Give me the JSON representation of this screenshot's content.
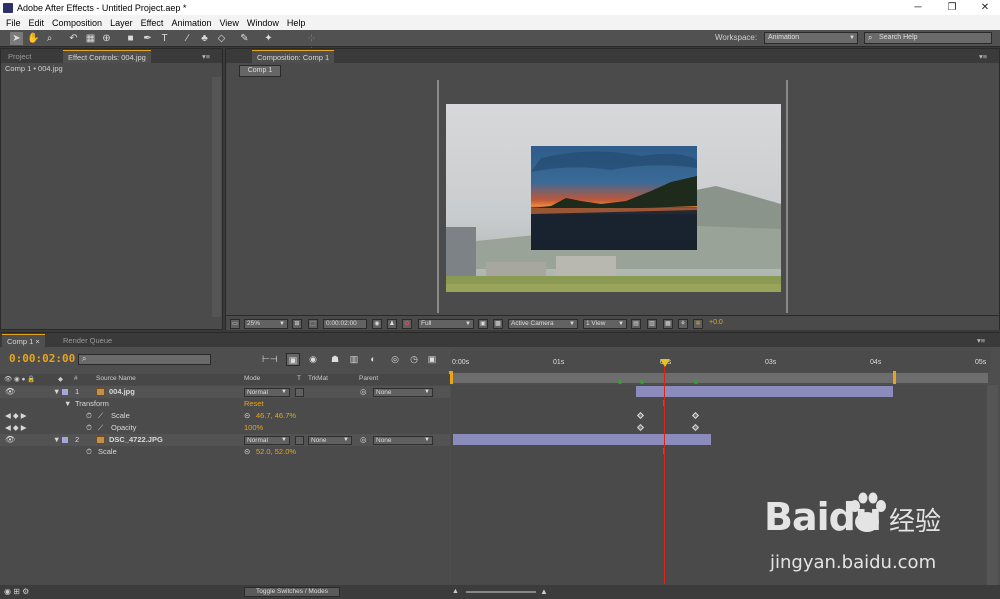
{
  "window": {
    "title": "Adobe After Effects - Untitled Project.aep *",
    "minimize": "─",
    "restore": "❐",
    "close": "✕"
  },
  "menu": [
    "File",
    "Edit",
    "Composition",
    "Layer",
    "Effect",
    "Animation",
    "View",
    "Window",
    "Help"
  ],
  "toolbar": {
    "workspace_label": "Workspace:",
    "workspace_value": "Animation",
    "search_placeholder": "Search Help"
  },
  "left_panel": {
    "tabs": [
      "Project",
      "Effect Controls: 004.jpg"
    ],
    "subtitle": "Comp 1 • 004.jpg"
  },
  "comp_panel": {
    "tab": "Composition: Comp 1",
    "sub_tab": "Comp 1",
    "zoom": "25%",
    "timecode": "0:00:02:00",
    "resolution": "Full",
    "camera": "Active Camera",
    "views": "1 View",
    "exposure": "+0.0"
  },
  "timeline": {
    "tabs": [
      "Comp 1",
      "Render Queue"
    ],
    "timecode": "0:00:02:00",
    "ruler_labels": [
      "0:00s",
      "01s",
      "02s",
      "03s",
      "04s",
      "05s"
    ],
    "columns": {
      "num": "#",
      "source": "Source Name",
      "mode": "Mode",
      "t": "T",
      "trkmat": "TrkMat",
      "parent": "Parent"
    },
    "layers": [
      {
        "num": "1",
        "name": "004.jpg",
        "mode": "Normal",
        "parent": "None",
        "transform_label": "Transform",
        "reset_label": "Reset",
        "props": [
          {
            "name": "Scale",
            "value": "46.7, 46.7%"
          },
          {
            "name": "Opacity",
            "value": "100%"
          }
        ]
      },
      {
        "num": "2",
        "name": "DSC_4722.JPG",
        "mode": "Normal",
        "trkmat": "None",
        "parent": "None",
        "props": [
          {
            "name": "Scale",
            "value": "52.0, 52.0%"
          }
        ]
      }
    ],
    "toggle_label": "Toggle Switches / Modes"
  },
  "watermark": {
    "logo": "Bai",
    "logo2": "du",
    "cn": "经验",
    "url": "jingyan.baidu.com"
  },
  "colors": {
    "accent": "#e8a51c",
    "playhead": "#d9241b",
    "layer_bar": "#8c8cbc"
  }
}
